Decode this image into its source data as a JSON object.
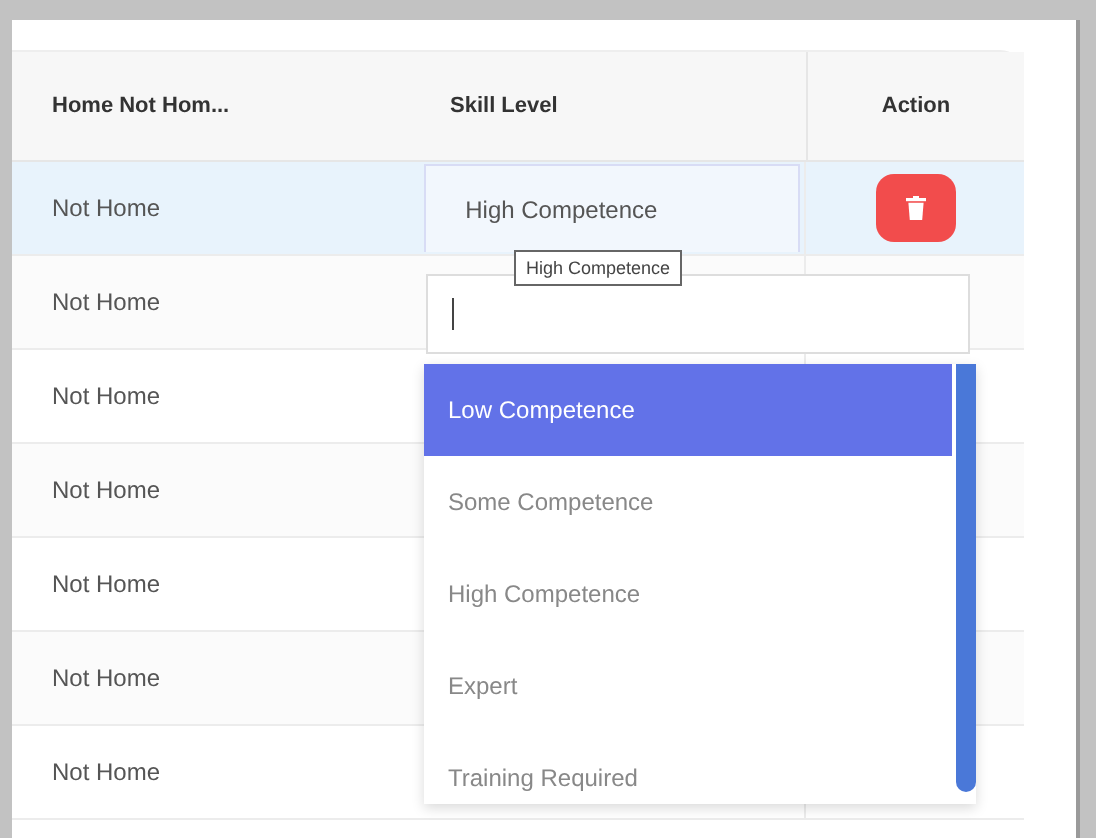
{
  "table": {
    "columns": [
      "Home Not Hom...",
      "Skill Level",
      "Action"
    ],
    "rows": [
      {
        "home": "Not Home",
        "skill": "High Competence",
        "selected": true,
        "deletable": true
      },
      {
        "home": "Not Home",
        "selected": false,
        "deletable": false
      },
      {
        "home": "Not Home",
        "selected": false,
        "deletable": false
      },
      {
        "home": "Not Home",
        "selected": false,
        "deletable": false
      },
      {
        "home": "Not Home",
        "selected": false,
        "deletable": false
      },
      {
        "home": "Not Home",
        "selected": false,
        "deletable": false
      },
      {
        "home": "Not Home",
        "selected": false,
        "deletable": false
      }
    ]
  },
  "tooltip": {
    "text": "High Competence"
  },
  "dropdown": {
    "options": [
      {
        "label": "Low Competence",
        "selected": true
      },
      {
        "label": "Some Competence",
        "selected": false
      },
      {
        "label": "High Competence",
        "selected": false
      },
      {
        "label": "Expert",
        "selected": false
      },
      {
        "label": "Training Required",
        "selected": false
      }
    ]
  }
}
